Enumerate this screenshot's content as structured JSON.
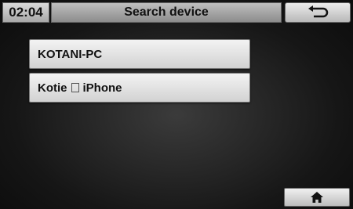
{
  "status_bar": {
    "time": "02:04",
    "title": "Search device",
    "back_icon": "return-arrow-icon"
  },
  "devices": [
    {
      "name": "KOTANI-PC"
    },
    {
      "name_prefix": "Kotie",
      "name_suffix": "iPhone"
    }
  ],
  "footer": {
    "home_icon": "home-icon"
  }
}
